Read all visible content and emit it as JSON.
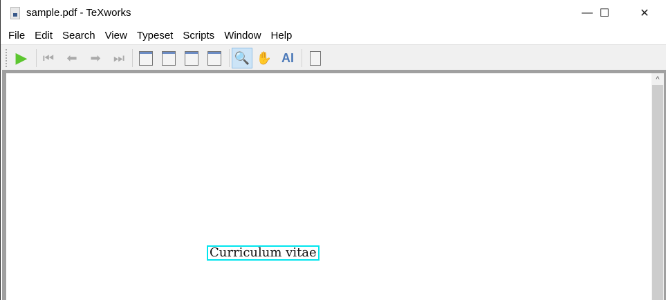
{
  "window": {
    "title": "sample.pdf - TeXworks",
    "minimize": "—",
    "maximize": "☐",
    "close": "✕"
  },
  "menu": [
    "File",
    "Edit",
    "Search",
    "View",
    "Typeset",
    "Scripts",
    "Window",
    "Help"
  ],
  "toolbar": {
    "typeset": "▶",
    "first": "⏮",
    "prev": "⬅",
    "next": "➡",
    "last": "⏭",
    "hand": "✋",
    "select_text": "AI",
    "magnify": "🔍"
  },
  "document": {
    "text": "Curriculum vitae",
    "highlight_color": "#00e5ee"
  },
  "scrollbar": {
    "up": "^"
  }
}
